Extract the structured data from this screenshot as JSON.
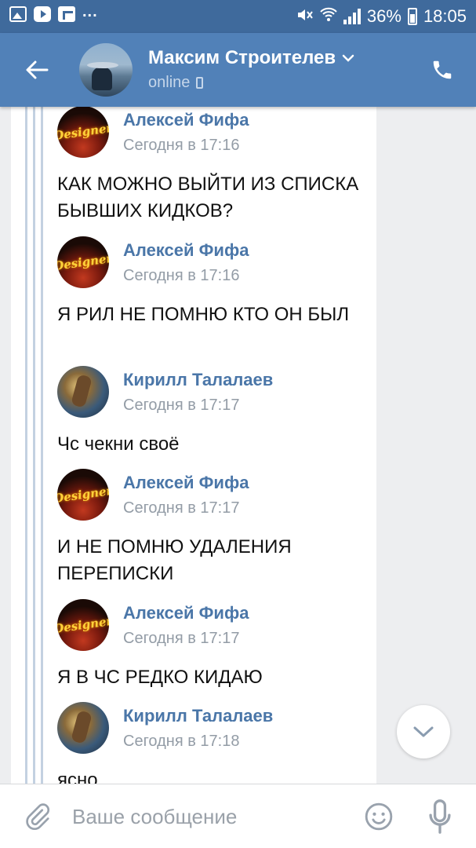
{
  "status_bar": {
    "left_icons": [
      "gallery-icon",
      "youtube-icon",
      "flipboard-icon"
    ],
    "more": "...",
    "battery_percent": "36%",
    "time": "18:05"
  },
  "header": {
    "contact_name": "Максим Строителев",
    "status": "online"
  },
  "messages": [
    {
      "author": "Алексей Фифа",
      "time": "Сегодня в 17:16",
      "text": "КАК МОЖНО ВЫЙТИ ИЗ СПИСКА БЫВШИХ КИДКОВ?",
      "avatar_text": "Designer",
      "avatar_type": "designer"
    },
    {
      "author": "Алексей Фифа",
      "time": "Сегодня в 17:16",
      "text": "Я РИЛ НЕ ПОМНЮ КТО ОН БЫЛ",
      "avatar_text": "Designer",
      "avatar_type": "designer"
    },
    {
      "author": "Кирилл Талалаев",
      "time": "Сегодня в 17:17",
      "text": "Чс чекни своё",
      "avatar_type": "hero"
    },
    {
      "author": "Алексей Фифа",
      "time": "Сегодня в 17:17",
      "text": "И НЕ ПОМНЮ УДАЛЕНИЯ ПЕРЕПИСКИ",
      "avatar_text": "Designer",
      "avatar_type": "designer"
    },
    {
      "author": "Алексей Фифа",
      "time": "Сегодня в 17:17",
      "text": "Я В ЧС РЕДКО КИДАЮ",
      "avatar_text": "Designer",
      "avatar_type": "designer"
    },
    {
      "author": "Кирилл Талалаев",
      "time": "Сегодня в 17:18",
      "text": "ясно",
      "avatar_type": "hero"
    }
  ],
  "composer": {
    "placeholder": "Ваше сообщение"
  },
  "colors": {
    "header": "#5181b8",
    "status_bar": "#3f6a9c",
    "author_link": "#4a76a8",
    "forward_line": "#c3d1e1"
  }
}
